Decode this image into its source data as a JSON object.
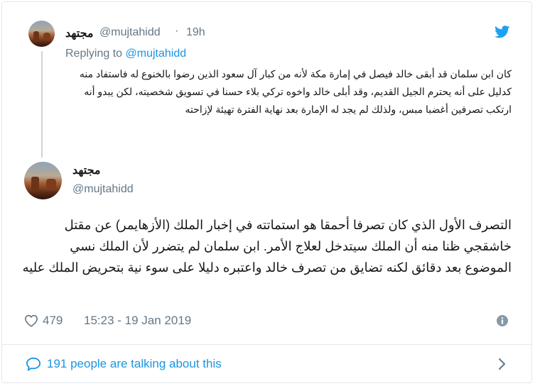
{
  "reply_tweet": {
    "display_name": "مجتهد",
    "handle": "@mujtahidd",
    "separator": "·",
    "time": "19h",
    "replying_prefix": "Replying to ",
    "replying_to": "@mujtahidd",
    "text": "كان ابن سلمان قد أبقى خالد فيصل في إمارة مكة لأنه من كبار آل سعود الذين رضوا بالخنوع له فاستفاد منه كدليل على أنه يحترم الجيل القديم، وقد أبلى خالد واخوه تركي بلاء حسنا في تسويق شخصيته، لكن يبدو أنه ارتكب تصرفين أغضبا مبس، ولذلك لم يجد له الإمارة بعد نهاية الفترة تهيئة لإزاحته"
  },
  "main_tweet": {
    "display_name": "مجتهد",
    "handle": "@mujtahidd",
    "text": "التصرف الأول الذي كان تصرفا أحمقا هو استماتته في إخبار الملك (الأزهايمر) عن مقتل خاشقجي ظنا منه أن الملك سيتدخل لعلاج الأمر. ابن سلمان لم يتضرر لأن الملك نسي الموضوع بعد دقائق لكنه تضايق من تصرف خالد واعتبره دليلا على سوء نية بتحريض الملك عليه",
    "likes": "479",
    "timestamp": "15:23 - 19 Jan 2019"
  },
  "footer": {
    "talking_text": "191 people are talking about this"
  },
  "icons": {
    "brand": "twitter-bird-icon",
    "like": "heart-icon",
    "info": "info-icon",
    "conversation": "speech-bubble-icon",
    "chevron": "chevron-right-icon"
  },
  "colors": {
    "brand_blue": "#1da1f2",
    "link_blue": "#1b95e0",
    "muted_gray": "#657786",
    "border": "#e1e8ed"
  }
}
